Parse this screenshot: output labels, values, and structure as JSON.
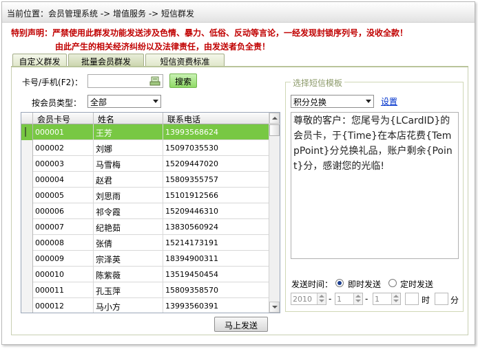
{
  "breadcrumb": "当前位置：会员管理系统 -> 增值服务 -> 短信群发",
  "notice": {
    "line1": "特别声明：严禁使用此群发功能发送涉及色情、暴力、低俗、反动等言论，一经发现封锁序列号，没收全款！",
    "line2": "由此产生的相关经济纠纷以及法律责任，由发送者负全责！"
  },
  "tabs": [
    "自定义群发",
    "批量会员群发",
    "短信资费标准"
  ],
  "search": {
    "card_label": "卡号/手机(F2)：",
    "card_value": "",
    "search_button": "搜索",
    "type_label": "按会员类型：",
    "type_value": "全部"
  },
  "grid": {
    "columns": [
      "会员卡号",
      "姓名",
      "联系电话"
    ],
    "rows": [
      {
        "card": "000001",
        "name": "王芳",
        "phone": "13993568624"
      },
      {
        "card": "000002",
        "name": "刘娜",
        "phone": "15097035530"
      },
      {
        "card": "000003",
        "name": "马雪梅",
        "phone": "15209447020"
      },
      {
        "card": "000004",
        "name": "赵君",
        "phone": "15809355757"
      },
      {
        "card": "000005",
        "name": "刘思雨",
        "phone": "15101912566"
      },
      {
        "card": "000006",
        "name": "祁令霞",
        "phone": "15209446310"
      },
      {
        "card": "000007",
        "name": "纪艳茹",
        "phone": "13830560924"
      },
      {
        "card": "000008",
        "name": "张倩",
        "phone": "15214173191"
      },
      {
        "card": "000009",
        "name": "宗泽英",
        "phone": "18394900311"
      },
      {
        "card": "000010",
        "name": "陈紫薇",
        "phone": "13519450454"
      },
      {
        "card": "000011",
        "name": "孔玉萍",
        "phone": "15809358570"
      },
      {
        "card": "000012",
        "name": "马小方",
        "phone": "13993560391"
      }
    ]
  },
  "template": {
    "legend": "选择短信模板",
    "selected": "积分兑换",
    "settings_link": "设置",
    "message": "尊敬的客户：您尾号为{LCardID}的会员卡，于{Time}在本店花费{TempPoint}分兑换礼品，账户剩余{Point}分，感谢您的光临!"
  },
  "send_time": {
    "label": "发送时间：",
    "immediate": "即时发送",
    "scheduled": "定时发送",
    "year": "2010",
    "month": "1",
    "day": "1",
    "sep": "-",
    "hour_unit": "时",
    "minute_unit": "分"
  },
  "send_button": "马上发送"
}
